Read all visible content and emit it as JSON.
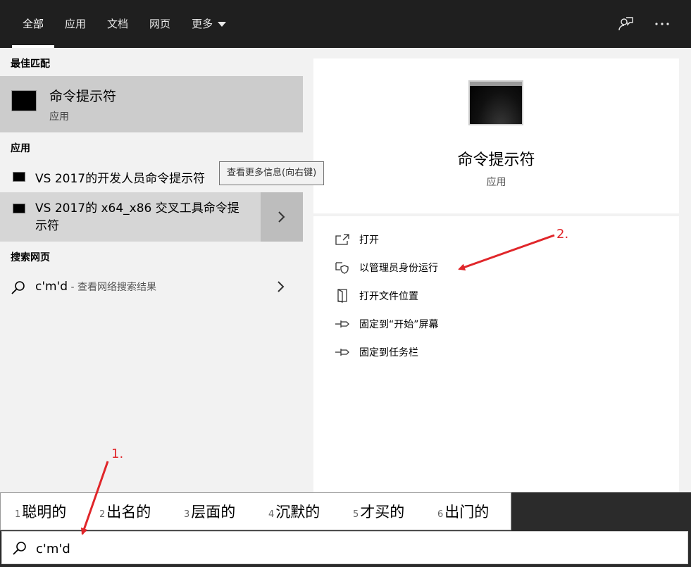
{
  "tabs": [
    {
      "label": "全部",
      "active": true
    },
    {
      "label": "应用"
    },
    {
      "label": "文档"
    },
    {
      "label": "网页"
    },
    {
      "label": "更多"
    }
  ],
  "left": {
    "best_match_heading": "最佳匹配",
    "best_match": {
      "title": "命令提示符",
      "subtitle": "应用"
    },
    "apps_heading": "应用",
    "apps": [
      {
        "label": "VS 2017的开发人员命令提示符"
      },
      {
        "label_line1": "VS 2017的 x64_x86 交叉工具命令提",
        "label_line2": "示符"
      }
    ],
    "tooltip": "查看更多信息(向右键)",
    "web_heading": "搜索网页",
    "web_query": "c'm'd",
    "web_hint": " - 查看网络搜索结果"
  },
  "right": {
    "title": "命令提示符",
    "subtitle": "应用",
    "actions": [
      {
        "label": "打开",
        "icon": "open-icon"
      },
      {
        "label": "以管理员身份运行",
        "icon": "shield-icon"
      },
      {
        "label": "打开文件位置",
        "icon": "folder-icon"
      },
      {
        "label": "固定到“开始”屏幕",
        "icon": "pin-icon"
      },
      {
        "label": "固定到任务栏",
        "icon": "pin-icon"
      }
    ]
  },
  "ime": {
    "candidates": [
      {
        "num": "1",
        "word": "聪明的"
      },
      {
        "num": "2",
        "word": "出名的"
      },
      {
        "num": "3",
        "word": "层面的"
      },
      {
        "num": "4",
        "word": "沉默的"
      },
      {
        "num": "5",
        "word": "才买的"
      },
      {
        "num": "6",
        "word": "出门的"
      }
    ]
  },
  "search": {
    "value": "c'm'd"
  },
  "annotations": {
    "step1": "1.",
    "step2": "2."
  },
  "colors": {
    "accent_red": "#e0262a",
    "topbar": "#1f1f1f",
    "selected": "#cccccc"
  }
}
